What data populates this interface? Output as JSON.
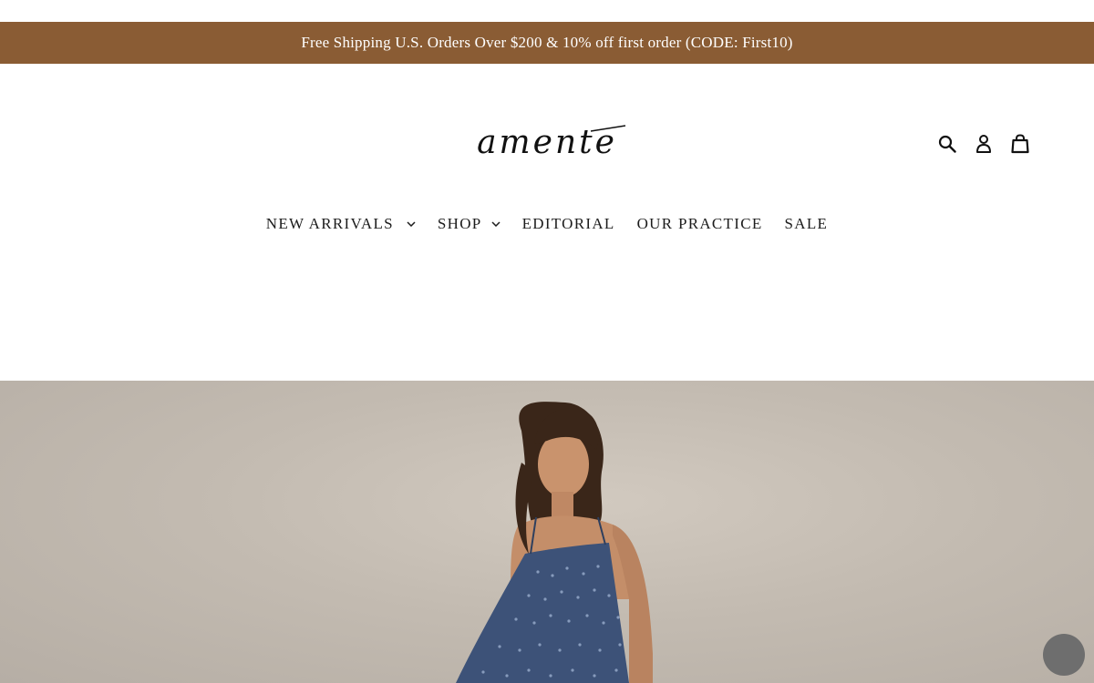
{
  "announcement": {
    "text": "Free Shipping U.S. Orders Over $200 & 10% off first order (CODE: First10)",
    "background": "#8a5c34"
  },
  "header": {
    "logo_text": "amente",
    "icons": [
      "search-icon",
      "account-icon",
      "cart-icon"
    ]
  },
  "nav": {
    "items": [
      {
        "label": "NEW ARRIVALS",
        "has_dropdown": true
      },
      {
        "label": "SHOP",
        "has_dropdown": true
      },
      {
        "label": "EDITORIAL",
        "has_dropdown": false
      },
      {
        "label": "OUR PRACTICE",
        "has_dropdown": false
      },
      {
        "label": "SALE",
        "has_dropdown": false
      }
    ]
  },
  "hero": {
    "image": "model in navy polka-dot strappy dress against beige backdrop"
  },
  "colors": {
    "accent": "#8a5c34",
    "text": "#1c1c1c",
    "chat": "#6e6e6e"
  }
}
